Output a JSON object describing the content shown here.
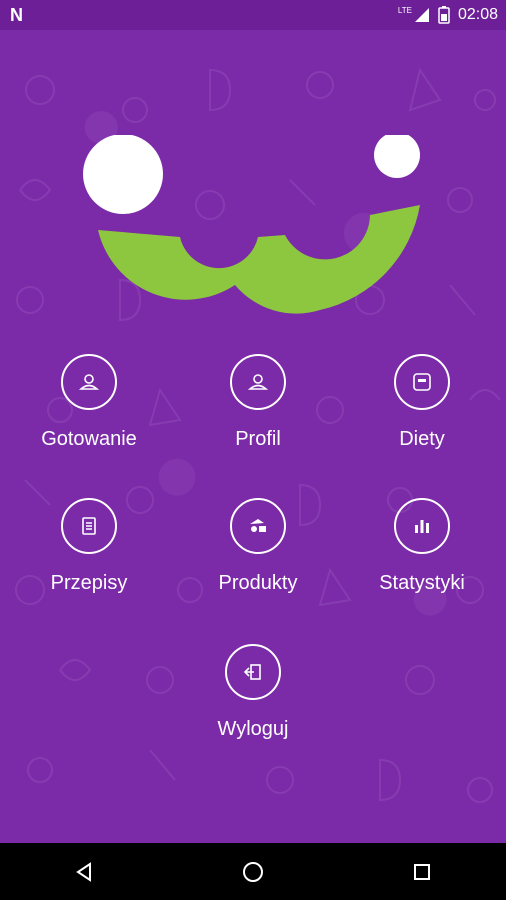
{
  "status_bar": {
    "carrier_logo": "N",
    "signal_label": "LTE",
    "time": "02:08"
  },
  "menu": {
    "items": [
      {
        "label": "Gotowanie",
        "icon": "person-icon"
      },
      {
        "label": "Profil",
        "icon": "person-icon"
      },
      {
        "label": "Diety",
        "icon": "scale-icon"
      },
      {
        "label": "Przepisy",
        "icon": "document-icon"
      },
      {
        "label": "Produkty",
        "icon": "groceries-icon"
      },
      {
        "label": "Statystyki",
        "icon": "bar-chart-icon"
      },
      {
        "label": "Wyloguj",
        "icon": "logout-icon"
      }
    ]
  },
  "colors": {
    "background": "#7b2aa8",
    "logo_green": "#8dc63f",
    "logo_white": "#ffffff",
    "navbar": "#000000"
  }
}
